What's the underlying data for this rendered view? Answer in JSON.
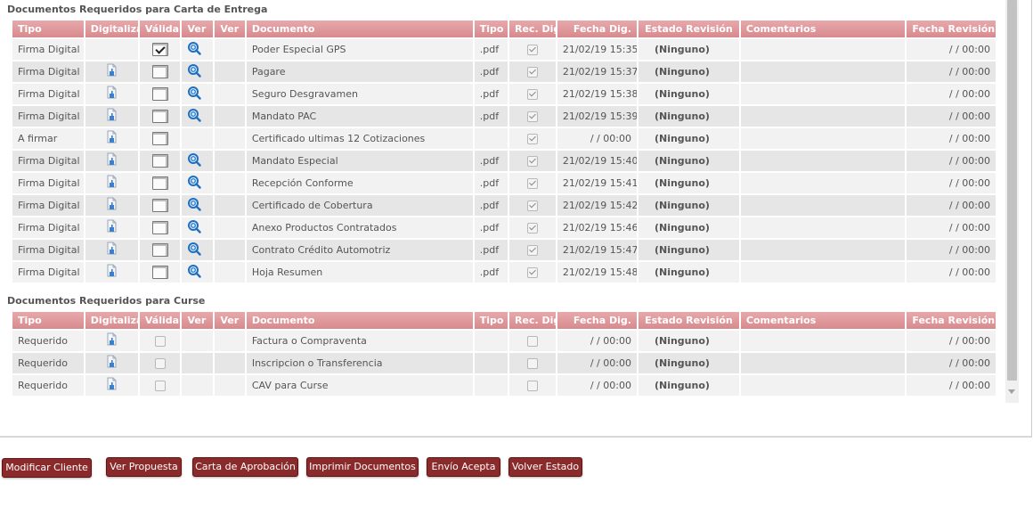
{
  "sections": {
    "carta_title": "Documentos Requeridos para Carta de Entrega",
    "curse_title": "Documentos Requeridos para Curse"
  },
  "headers": [
    "Tipo",
    "Digitalizar",
    "Válida",
    "Ver",
    "Ver",
    "Documento",
    "Tipo",
    "Rec. Dig.",
    "Fecha Dig.",
    "Estado Revisión",
    "Comentarios",
    "Fecha Revisión"
  ],
  "carta_rows": [
    {
      "tipo": "Firma Digital",
      "digitalizar": false,
      "valida": true,
      "ver": true,
      "documento": "Poder Especial GPS",
      "tipo_archivo": ".pdf",
      "rec_dig": true,
      "fecha_dig": "21/02/19 15:35",
      "estado": "(Ninguno)",
      "comentarios": "",
      "fecha_revision": "/ / 00:00"
    },
    {
      "tipo": "Firma Digital",
      "digitalizar": true,
      "valida": false,
      "ver": true,
      "documento": "Pagare",
      "tipo_archivo": ".pdf",
      "rec_dig": true,
      "fecha_dig": "21/02/19 15:37",
      "estado": "(Ninguno)",
      "comentarios": "",
      "fecha_revision": "/ / 00:00"
    },
    {
      "tipo": "Firma Digital",
      "digitalizar": true,
      "valida": false,
      "ver": true,
      "documento": "Seguro Desgravamen",
      "tipo_archivo": ".pdf",
      "rec_dig": true,
      "fecha_dig": "21/02/19 15:38",
      "estado": "(Ninguno)",
      "comentarios": "",
      "fecha_revision": "/ / 00:00"
    },
    {
      "tipo": "Firma Digital",
      "digitalizar": true,
      "valida": false,
      "ver": true,
      "documento": "Mandato PAC",
      "tipo_archivo": ".pdf",
      "rec_dig": true,
      "fecha_dig": "21/02/19 15:39",
      "estado": "(Ninguno)",
      "comentarios": "",
      "fecha_revision": "/ / 00:00"
    },
    {
      "tipo": "A firmar",
      "digitalizar": true,
      "valida": false,
      "ver": false,
      "documento": "Certificado ultimas 12 Cotizaciones",
      "tipo_archivo": "",
      "rec_dig": true,
      "fecha_dig": "/ / 00:00",
      "estado": "(Ninguno)",
      "comentarios": "",
      "fecha_revision": "/ / 00:00"
    },
    {
      "tipo": "Firma Digital",
      "digitalizar": true,
      "valida": false,
      "ver": true,
      "documento": "Mandato Especial",
      "tipo_archivo": ".pdf",
      "rec_dig": true,
      "fecha_dig": "21/02/19 15:40",
      "estado": "(Ninguno)",
      "comentarios": "",
      "fecha_revision": "/ / 00:00"
    },
    {
      "tipo": "Firma Digital",
      "digitalizar": true,
      "valida": false,
      "ver": true,
      "documento": "Recepción Conforme",
      "tipo_archivo": ".pdf",
      "rec_dig": true,
      "fecha_dig": "21/02/19 15:41",
      "estado": "(Ninguno)",
      "comentarios": "",
      "fecha_revision": "/ / 00:00"
    },
    {
      "tipo": "Firma Digital",
      "digitalizar": true,
      "valida": false,
      "ver": true,
      "documento": "Certificado de Cobertura",
      "tipo_archivo": ".pdf",
      "rec_dig": true,
      "fecha_dig": "21/02/19 15:42",
      "estado": "(Ninguno)",
      "comentarios": "",
      "fecha_revision": "/ / 00:00"
    },
    {
      "tipo": "Firma Digital",
      "digitalizar": true,
      "valida": false,
      "ver": true,
      "documento": "Anexo Productos Contratados",
      "tipo_archivo": ".pdf",
      "rec_dig": true,
      "fecha_dig": "21/02/19 15:46",
      "estado": "(Ninguno)",
      "comentarios": "",
      "fecha_revision": "/ / 00:00"
    },
    {
      "tipo": "Firma Digital",
      "digitalizar": true,
      "valida": false,
      "ver": true,
      "documento": "Contrato Crédito Automotriz",
      "tipo_archivo": ".pdf",
      "rec_dig": true,
      "fecha_dig": "21/02/19 15:47",
      "estado": "(Ninguno)",
      "comentarios": "",
      "fecha_revision": "/ / 00:00"
    },
    {
      "tipo": "Firma Digital",
      "digitalizar": true,
      "valida": false,
      "ver": true,
      "documento": "Hoja Resumen",
      "tipo_archivo": ".pdf",
      "rec_dig": true,
      "fecha_dig": "21/02/19 15:48",
      "estado": "(Ninguno)",
      "comentarios": "",
      "fecha_revision": "/ / 00:00"
    }
  ],
  "curse_rows": [
    {
      "tipo": "Requerido",
      "digitalizar": true,
      "valida": false,
      "documento": "Factura o Compraventa",
      "tipo_archivo": "",
      "rec_dig": false,
      "fecha_dig": "/ / 00:00",
      "estado": "(Ninguno)",
      "comentarios": "",
      "fecha_revision": "/ / 00:00"
    },
    {
      "tipo": "Requerido",
      "digitalizar": true,
      "valida": false,
      "documento": "Inscripcion o Transferencia",
      "tipo_archivo": "",
      "rec_dig": false,
      "fecha_dig": "/ / 00:00",
      "estado": "(Ninguno)",
      "comentarios": "",
      "fecha_revision": "/ / 00:00"
    },
    {
      "tipo": "Requerido",
      "digitalizar": true,
      "valida": false,
      "documento": "CAV para Curse",
      "tipo_archivo": "",
      "rec_dig": false,
      "fecha_dig": "/ / 00:00",
      "estado": "(Ninguno)",
      "comentarios": "",
      "fecha_revision": "/ / 00:00"
    }
  ],
  "buttons": {
    "modificar_cliente": "Modificar Cliente",
    "ver_propuesta": "Ver Propuesta",
    "carta_aprobacion": "Carta de Aprobación",
    "imprimir_documentos": "Imprimir Documentos",
    "envio_acepta": "Envío Acepta",
    "volver_estado": "Volver Estado"
  },
  "colors": {
    "header_bg": "#d98b8f",
    "button_bg": "#8b2a2a",
    "row_even": "#f2f2f2",
    "row_odd": "#e6e6e6"
  },
  "icons": {
    "digitalizar": "scan-document-icon",
    "ver": "magnifier-icon",
    "valida": "checkbox-icon"
  }
}
